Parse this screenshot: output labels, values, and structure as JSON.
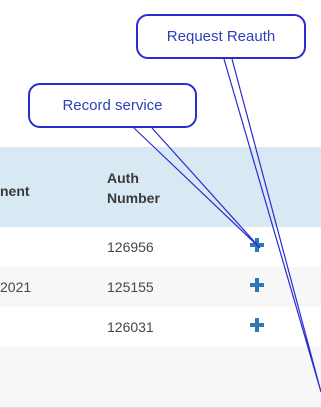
{
  "table": {
    "headers": {
      "col1": "nent",
      "col2_line1": "Auth",
      "col2_line2": "Number"
    },
    "rows": [
      {
        "col1": "",
        "auth_number": "126956"
      },
      {
        "col1": "2021",
        "auth_number": "125155"
      },
      {
        "col1": "",
        "auth_number": "126031"
      }
    ]
  },
  "callouts": {
    "request_reauth": "Request Reauth",
    "record_service": "Record service"
  },
  "colors": {
    "header_bg": "#d8e9f4",
    "plus_blue": "#2e78b7",
    "callout_border": "#2b2bd1"
  },
  "icons": {
    "add": "plus-icon"
  }
}
